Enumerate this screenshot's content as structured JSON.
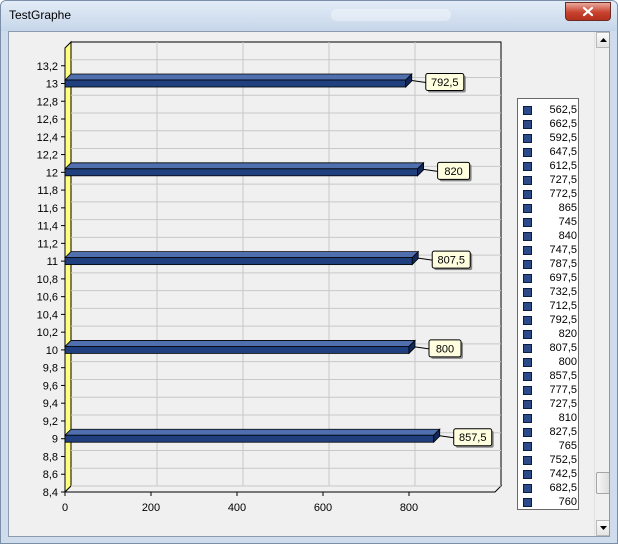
{
  "window": {
    "title": "TestGraphe"
  },
  "icons": {
    "close": "close-icon",
    "scroll_up": "chevron-up-icon",
    "scroll_down": "chevron-down-icon"
  },
  "colors": {
    "bar": "#1f3f7f",
    "label_bg": "#ffffe0",
    "wall": "#ffff80",
    "accent_close": "#c8422e"
  },
  "chart_data": {
    "type": "bar",
    "orientation": "horizontal",
    "style": "3d",
    "title": "",
    "xlabel": "",
    "ylabel": "",
    "xlim": [
      0,
      1000
    ],
    "ylim": [
      8.4,
      13.4
    ],
    "x_ticks": [
      "0",
      "200",
      "400",
      "600",
      "800"
    ],
    "x_tick_values": [
      0,
      200,
      400,
      600,
      800
    ],
    "y_ticks": [
      "8,4",
      "8,6",
      "8,8",
      "9",
      "9,2",
      "9,4",
      "9,6",
      "9,8",
      "10",
      "10,2",
      "10,4",
      "10,6",
      "10,8",
      "11",
      "11,2",
      "11,4",
      "11,6",
      "11,8",
      "12",
      "12,2",
      "12,4",
      "12,6",
      "12,8",
      "13",
      "13,2"
    ],
    "y_tick_values": [
      8.4,
      8.6,
      8.8,
      9,
      9.2,
      9.4,
      9.6,
      9.8,
      10,
      10.2,
      10.4,
      10.6,
      10.8,
      11,
      11.2,
      11.4,
      11.6,
      11.8,
      12,
      12.2,
      12.4,
      12.6,
      12.8,
      13,
      13.2
    ],
    "bars": [
      {
        "y": 9,
        "value": 857.5,
        "label": "857,5"
      },
      {
        "y": 10,
        "value": 800,
        "label": "800"
      },
      {
        "y": 11,
        "value": 807.5,
        "label": "807,5"
      },
      {
        "y": 12,
        "value": 820,
        "label": "820"
      },
      {
        "y": 13,
        "value": 792.5,
        "label": "792,5"
      }
    ],
    "grid": true,
    "legend_position": "right",
    "legend": [
      "562,5",
      "662,5",
      "592,5",
      "647,5",
      "612,5",
      "727,5",
      "772,5",
      "865",
      "745",
      "840",
      "747,5",
      "787,5",
      "697,5",
      "732,5",
      "712,5",
      "792,5",
      "820",
      "807,5",
      "800",
      "857,5",
      "777,5",
      "727,5",
      "810",
      "827,5",
      "765",
      "752,5",
      "742,5",
      "682,5",
      "760"
    ]
  }
}
